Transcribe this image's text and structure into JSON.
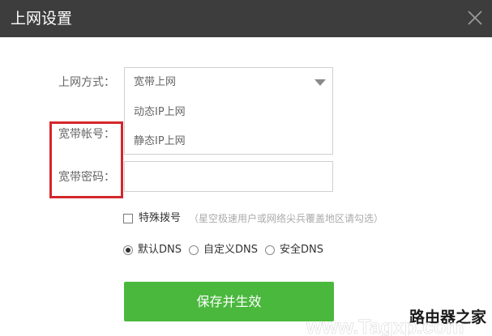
{
  "dialog": {
    "title": "上网设置",
    "close_icon": "close-icon"
  },
  "form": {
    "connection_type": {
      "label": "上网方式：",
      "selected": "宽带上网",
      "options": [
        "动态IP上网",
        "静态IP上网"
      ]
    },
    "account_label": "宽带帐号：",
    "password_label": "宽带密码：",
    "password_value": ""
  },
  "special_dial": {
    "checked": false,
    "label": "特殊拨号",
    "hint": "（星空极速用户或网络尖兵覆盖地区请勾选）"
  },
  "dns": {
    "options": [
      "默认DNS",
      "自定义DNS",
      "安全DNS"
    ],
    "selected": "默认DNS"
  },
  "save_button": "保存并生效",
  "highlight_color": "#d3272c",
  "watermark": {
    "text": "路由器之家",
    "url_text": "www.Tagxp.com"
  }
}
